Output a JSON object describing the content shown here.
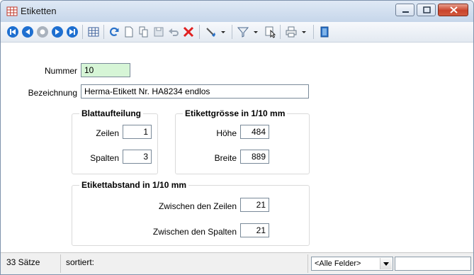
{
  "window": {
    "title": "Etiketten"
  },
  "toolbar": {
    "items": [
      "first-record-icon",
      "previous-record-icon",
      "current-record-icon",
      "next-record-icon",
      "last-record-icon",
      "table-view-icon",
      "refresh-icon",
      "new-document-icon",
      "copy-icon",
      "save-icon",
      "undo-icon",
      "delete-icon",
      "tools-icon",
      "filter-icon",
      "cursor-select-icon",
      "print-icon",
      "exit-icon"
    ]
  },
  "form": {
    "nummer_label": "Nummer",
    "nummer_value": "10",
    "bezeichnung_label": "Bezeichnung",
    "bezeichnung_value": "Herma-Etikett Nr. HA8234 endlos"
  },
  "blattaufteilung": {
    "title": "Blattaufteilung",
    "zeilen_label": "Zeilen",
    "zeilen_value": "1",
    "spalten_label": "Spalten",
    "spalten_value": "3"
  },
  "etikettgroesse": {
    "title": "Etikettgrösse in 1/10 mm",
    "hoehe_label": "Höhe",
    "hoehe_value": "484",
    "breite_label": "Breite",
    "breite_value": "889"
  },
  "etikettabstand": {
    "title": "Etikettabstand in 1/10 mm",
    "zeilen_label": "Zwischen den Zeilen",
    "zeilen_value": "21",
    "spalten_label": "Zwischen den Spalten",
    "spalten_value": "21"
  },
  "status": {
    "count": "33 Sätze",
    "sort_label": "sortiert:",
    "field_filter": "<Alle Felder>",
    "search_value": ""
  }
}
